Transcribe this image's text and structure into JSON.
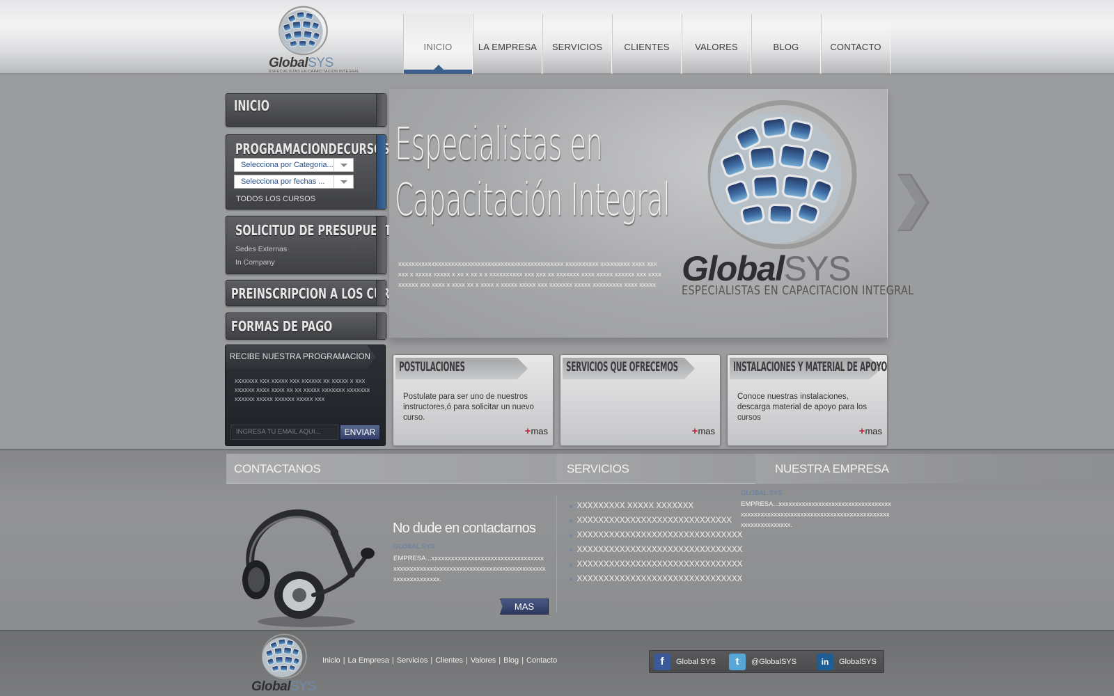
{
  "brand": {
    "name_main": "Global",
    "name_suffix": "SYS",
    "tagline": "ESPECIALISTAS EN CAPACITACION INTEGRAL"
  },
  "nav": {
    "items": [
      {
        "label": "INICIO",
        "active": true
      },
      {
        "label": "LA EMPRESA",
        "active": false
      },
      {
        "label": "SERVICIOS",
        "active": false
      },
      {
        "label": "CLIENTES",
        "active": false
      },
      {
        "label": "VALORES",
        "active": false
      },
      {
        "label": "BLOG",
        "active": false
      },
      {
        "label": "CONTACTO",
        "active": false
      }
    ]
  },
  "sidebar": {
    "inicio": "INICIO",
    "programacion": {
      "title": "PROGRAMACIONDECURSOS",
      "category_select": "Selecciona por Categoria...",
      "date_select": "Selecciona por fechas ...",
      "all_courses": "TODOS LOS CURSOS"
    },
    "presupuesto": {
      "title": "SOLICITUD DE PRESUPUESTO",
      "links": [
        "Sedes Externas",
        "In Company"
      ]
    },
    "preinscripcion": "PREINSCRIPCION A LOS CURSOS",
    "formas_pago": "FORMAS DE PAGO"
  },
  "newsletter": {
    "title": "RECIBE NUESTRA PROGRAMACION",
    "text": "xxxxxxx xxx   xxxxx xxx xxxxxx xx  xxxxx x xxx xxxxxx xxxx xxxx xx xx xxxxx xxxxxxx xxxxxxx xxxxxx xxxxx xxxxxx xxxxx xxx",
    "email_placeholder": "INGRESA TU EMAIL AQUI...",
    "button": "ENVIAR"
  },
  "hero": {
    "line1": "Especialistas en",
    "line2": "Capacitación Integral",
    "lorem": "xxxxxxxxxxxxxxxxxxxxxxxxxxxxxxxxxxxxxxxxxxxxxxxxxx     xxxxxxxxxx xxxxxxxxx xxxx xxx   xxx x xxxxx xxxxx  x xx x xx x      x  xxxxxxxxxx xxx xxx xx    xxxxxxx xxxx xxxxx xxxxxx xxx  xxxxxxxxxx xxx xxxx x xxxx xx x xxxx x xxxxx xxxxx xxx xxxxxxx xxxxx xxxxxxxxx xxxx xxxxx",
    "logo_main": "Global",
    "logo_suffix": "SYS",
    "logo_tag": "ESPECIALISTAS EN CAPACITACION INTEGRAL"
  },
  "cards": [
    {
      "title": "POSTULACIONES",
      "text": "Postulate para ser uno de nuestros instructores,ó para solicitar un nuevo curso.",
      "more": "mas"
    },
    {
      "title": "SERVICIOS QUE OFRECEMOS",
      "text": "",
      "more": "mas"
    },
    {
      "title": "INSTALACIONES Y MATERIAL DE APOYO",
      "text": "Conoce nuestras instalaciones, descarga material de apoyo para los cursos",
      "more": "mas"
    }
  ],
  "contact": {
    "heading": "CONTACTANOS",
    "title": "No dude en contactarnos",
    "brand": "GLOBAL SYS",
    "body": "EMPRESA...xxxxxxxxxxxxxxxxxxxxxxxxxxxxxxxxxxxxxxxxxxxxxxxxxxxxxxxxxxxxxxxxxxxxxxxxxxxxxxxxxxxxxxxxxxxxxx.",
    "button": "MAS"
  },
  "services": {
    "heading": "SERVICIOS",
    "items": [
      "XXXXXXXXX  XXXXX XXXXXXX",
      "XXXXXXXXXXXXXXXXXXXXXXXXXXXXX",
      "XXXXXXXXXXXXXXXXXXXXXXXXXXXXXXXXX",
      "XXXXXXXXXXXXXXXXXXXXXXXXXXXXXXXXX",
      "XXXXXXXXXXXXXXXXXXXXXXXXXXXXXXXXX",
      "XXXXXXXXXXXXXXXXXXXXXXXXXXXXXXX"
    ]
  },
  "empresa": {
    "heading": "NUESTRA EMPRESA",
    "brand": "GLOBAL SYS",
    "body": "EMPRESA...xxxxxxxxxxxxxxxxxxxxxxxxxxxxxxxxxxxxxxxxxxxxxxxxxxxxxxxxxxxxxxxxxxxxxxxxxxxxxxxxxxxxxxxxxxxxxx."
  },
  "footer": {
    "links": [
      "Inicio",
      "La Empresa",
      "Servicios",
      "Clientes",
      "Valores",
      "Blog",
      "Contacto"
    ],
    "social": [
      {
        "icon": "facebook-icon",
        "glyph": "f",
        "label": "Global SYS",
        "color": "#3b5998"
      },
      {
        "icon": "twitter-icon",
        "glyph": "t",
        "label": "@GlobalSYS",
        "color": "#58a6d6"
      },
      {
        "icon": "linkedin-icon",
        "glyph": "in",
        "label": "GlobalSYS",
        "color": "#1f5e95"
      }
    ]
  },
  "colors": {
    "accent_blue": "#3c5f8b",
    "plus_red": "#c0223c"
  }
}
